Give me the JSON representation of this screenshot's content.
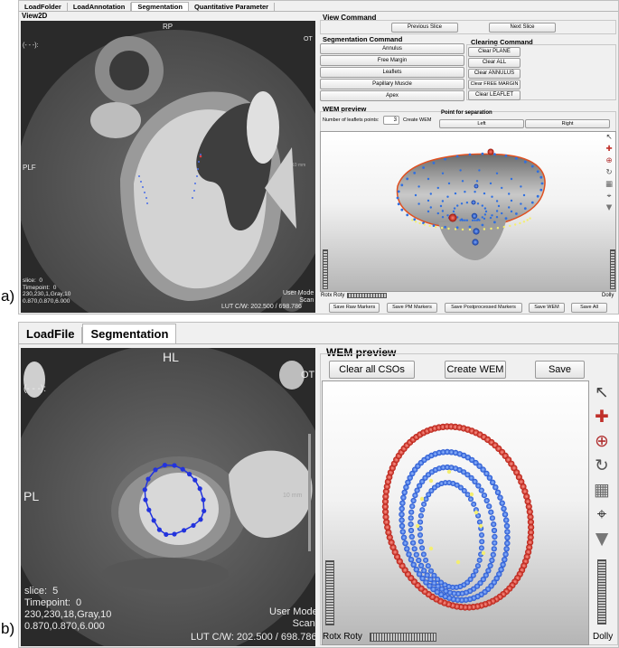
{
  "panel_a": {
    "label": "a)",
    "tabs": [
      "LoadFolder",
      "LoadAnnotation",
      "Segmentation",
      "Quantitative Parameter"
    ],
    "active_tab": 2,
    "view2d": {
      "title": "View2D",
      "orient_top": "RP",
      "orient_left": "PLF",
      "orient_right_top": "OT",
      "marker": "(- - -):",
      "scale_label": "10 mm",
      "info": "slice:  0\nTimepoint:  0\n230,230,1,Gray,10\n0.870,0.870,6.000",
      "user_mode": "User Mode\nScan",
      "lut": "LUT C/W: 202.500 / 698.786"
    },
    "view_command": {
      "title": "View Command",
      "prev": "Previous Slice",
      "next": "Next Slice"
    },
    "segmentation_command": {
      "title": "Segmentation Command",
      "buttons": [
        "Annulus",
        "Free Margin",
        "Leaflets",
        "Papillary Muscle",
        "Apex"
      ]
    },
    "clearing_command": {
      "title": "Clearing Command",
      "buttons": [
        "Clear PLANE",
        "Clear ALL",
        "Clear ANNULUS",
        "Clear FREE MARGIN",
        "Clear LEAFLET"
      ]
    },
    "wem_preview": {
      "title": "WEM preview",
      "leaflet_points_label": "Number of leaflets points:",
      "leaflet_points_value": "3",
      "create_wem": "Create WEM",
      "separation_title": "Point for separation",
      "left": "Left",
      "right": "Right",
      "rotx_roty": "Rotx Roty",
      "dolly": "Dolly"
    },
    "save_buttons": [
      "Save Raw Markers",
      "Save PM Markers",
      "Save Postprocessed Markers",
      "Save WEM",
      "Save All"
    ]
  },
  "panel_b": {
    "label": "b)",
    "tabs": [
      "LoadFile",
      "Segmentation"
    ],
    "active_tab": 1,
    "view2d": {
      "orient_top": "HL",
      "orient_left": "PL",
      "orient_right_top": "OT",
      "marker": "(- - -):",
      "scale_label": "10 mm",
      "info": "slice:  5\nTimepoint:  0\n230,230,18,Gray,10\n0.870,0.870,6.000",
      "user_mode": "User Mode\nScan:",
      "lut": "LUT C/W: 202.500 / 698.786"
    },
    "wem_preview": {
      "title": "WEM preview",
      "clear_all": "Clear all CSOs",
      "create_wem": "Create WEM",
      "save": "Save",
      "rotx_roty": "Rotx Roty",
      "dolly": "Dolly"
    }
  },
  "colors": {
    "marker_red": "#cc2a1e",
    "marker_blue": "#2f6fe0",
    "marker_yellow": "#f4ee70",
    "contour_blue": "#2233dd"
  },
  "icons_a": [
    "cursor-icon",
    "move-icon",
    "zoom-icon",
    "rotate-icon",
    "grid-icon",
    "center-icon",
    "shield-icon"
  ],
  "icons_b": [
    "cursor-icon",
    "move-icon",
    "zoom-icon",
    "rotate-icon",
    "grid-icon",
    "center-icon",
    "shield-icon"
  ]
}
